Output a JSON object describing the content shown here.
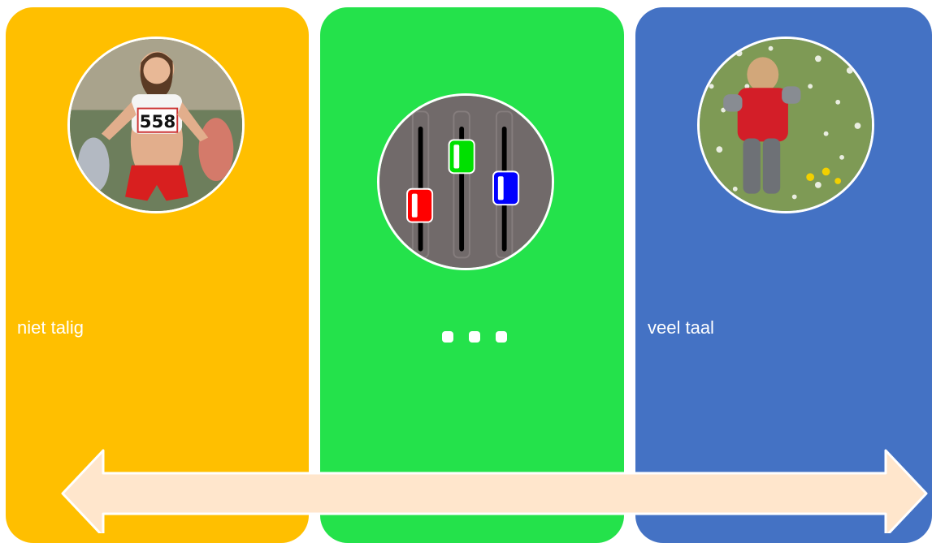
{
  "panels": [
    {
      "label": "niet talig",
      "color": "#FFBF00",
      "image": "sprinter-runner-photo"
    },
    {
      "label": "",
      "color": "#24E24B",
      "image": "mixer-sliders-icon",
      "ellipsis": "..."
    },
    {
      "label": "veel taal",
      "color": "#4472C4",
      "image": "toddler-meadow-photo"
    }
  ],
  "slider_colors": {
    "red": "#FF0000",
    "green": "#00E000",
    "blue": "#0000FF"
  },
  "arrow_color": "#FFE6CC",
  "runner_bib": "558"
}
